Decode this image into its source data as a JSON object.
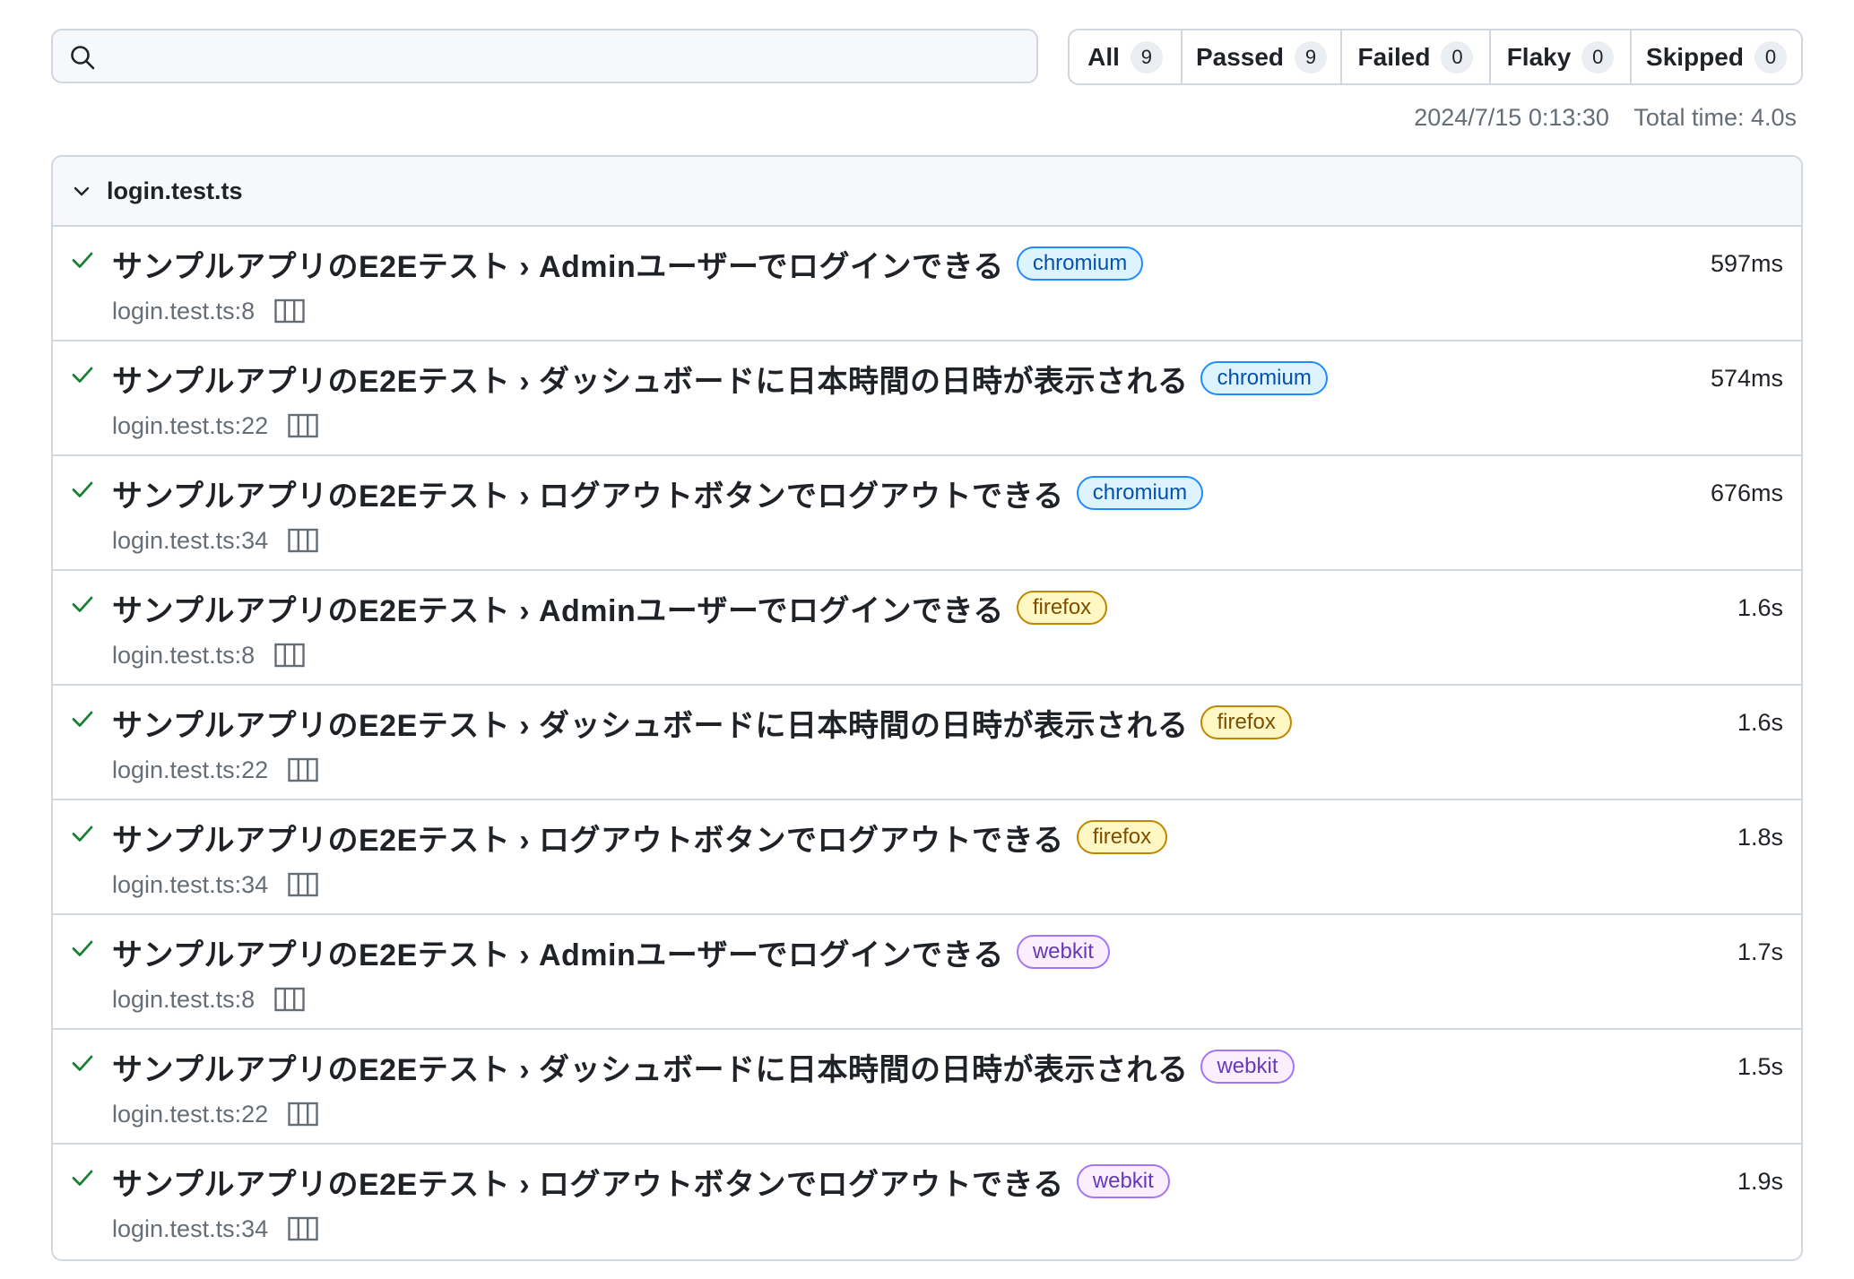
{
  "search": {
    "value": "",
    "placeholder": ""
  },
  "filters": [
    {
      "label": "All",
      "count": "9"
    },
    {
      "label": "Passed",
      "count": "9"
    },
    {
      "label": "Failed",
      "count": "0"
    },
    {
      "label": "Flaky",
      "count": "0"
    },
    {
      "label": "Skipped",
      "count": "0"
    }
  ],
  "meta": {
    "timestamp": "2024/7/15 0:13:30",
    "total_time": "Total time: 4.0s"
  },
  "file": {
    "name": "login.test.ts"
  },
  "tests": [
    {
      "title": "サンプルアプリのE2Eテスト › Adminユーザーでログインできる",
      "project": "chromium",
      "duration": "597ms",
      "location": "login.test.ts:8"
    },
    {
      "title": "サンプルアプリのE2Eテスト › ダッシュボードに日本時間の日時が表示される",
      "project": "chromium",
      "duration": "574ms",
      "location": "login.test.ts:22"
    },
    {
      "title": "サンプルアプリのE2Eテスト › ログアウトボタンでログアウトできる",
      "project": "chromium",
      "duration": "676ms",
      "location": "login.test.ts:34"
    },
    {
      "title": "サンプルアプリのE2Eテスト › Adminユーザーでログインできる",
      "project": "firefox",
      "duration": "1.6s",
      "location": "login.test.ts:8"
    },
    {
      "title": "サンプルアプリのE2Eテスト › ダッシュボードに日本時間の日時が表示される",
      "project": "firefox",
      "duration": "1.6s",
      "location": "login.test.ts:22"
    },
    {
      "title": "サンプルアプリのE2Eテスト › ログアウトボタンでログアウトできる",
      "project": "firefox",
      "duration": "1.8s",
      "location": "login.test.ts:34"
    },
    {
      "title": "サンプルアプリのE2Eテスト › Adminユーザーでログインできる",
      "project": "webkit",
      "duration": "1.7s",
      "location": "login.test.ts:8"
    },
    {
      "title": "サンプルアプリのE2Eテスト › ダッシュボードに日本時間の日時が表示される",
      "project": "webkit",
      "duration": "1.5s",
      "location": "login.test.ts:22"
    },
    {
      "title": "サンプルアプリのE2Eテスト › ログアウトボタンでログアウトできる",
      "project": "webkit",
      "duration": "1.9s",
      "location": "login.test.ts:34"
    }
  ],
  "colors": {
    "pass_icon": "#1a7f37",
    "chromium_tag": "#218bff",
    "firefox_tag": "#bf8700",
    "webkit_tag": "#a475f9",
    "border": "#d0d7de"
  },
  "icons": {
    "search": "search-icon",
    "file_toggle": "chevron-down-icon",
    "test_status": "check-icon",
    "trace": "columns-icon"
  }
}
